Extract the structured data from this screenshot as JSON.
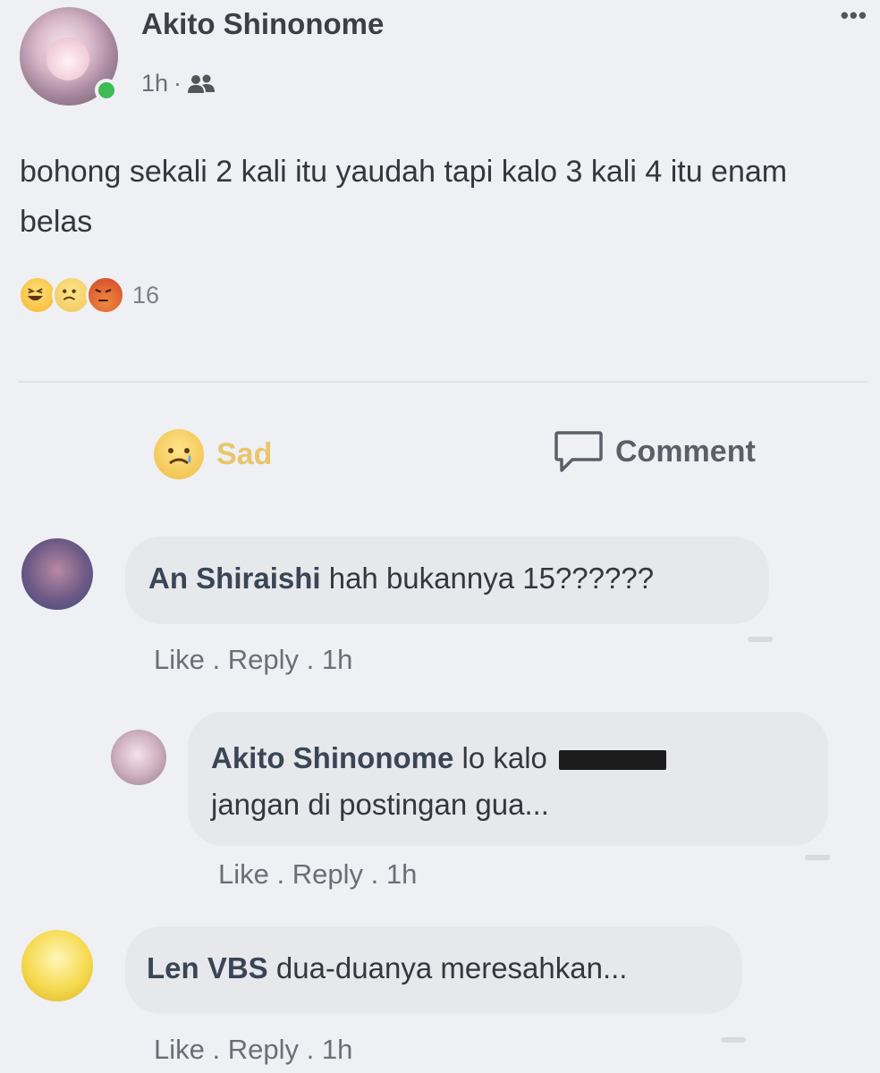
{
  "post": {
    "author": "Akito Shinonome",
    "time": "1h",
    "separator": "·",
    "body": "bohong sekali 2 kali itu yaudah tapi kalo 3 kali 4 itu enam belas",
    "menu_icon": "more-horizontal-icon",
    "audience_icon": "friends-icon"
  },
  "reactions": {
    "icons": [
      "haha-reaction-icon",
      "sad-reaction-icon",
      "angry-reaction-icon"
    ],
    "count": "16"
  },
  "actions": {
    "sad_label": "Sad",
    "comment_label": "Comment"
  },
  "comments": [
    {
      "name": "An Shiraishi",
      "text": "hah bukannya 15??????",
      "like": "Like",
      "reply": "Reply",
      "time": "1h"
    },
    {
      "name": "Akito Shinonome",
      "text_before_redaction": "lo kalo",
      "text_after_redaction": "jangan di postingan gua...",
      "like": "Like",
      "reply": "Reply",
      "time": "1h"
    },
    {
      "name": "Len VBS",
      "text": "dua-duanya meresahkan...",
      "like": "Like",
      "reply": "Reply",
      "time": "1h"
    }
  ],
  "colors": {
    "background": "#eef0f3",
    "bubble": "#e6e8eb",
    "online": "#3dbb54",
    "sad_active": "#e9c56b"
  }
}
